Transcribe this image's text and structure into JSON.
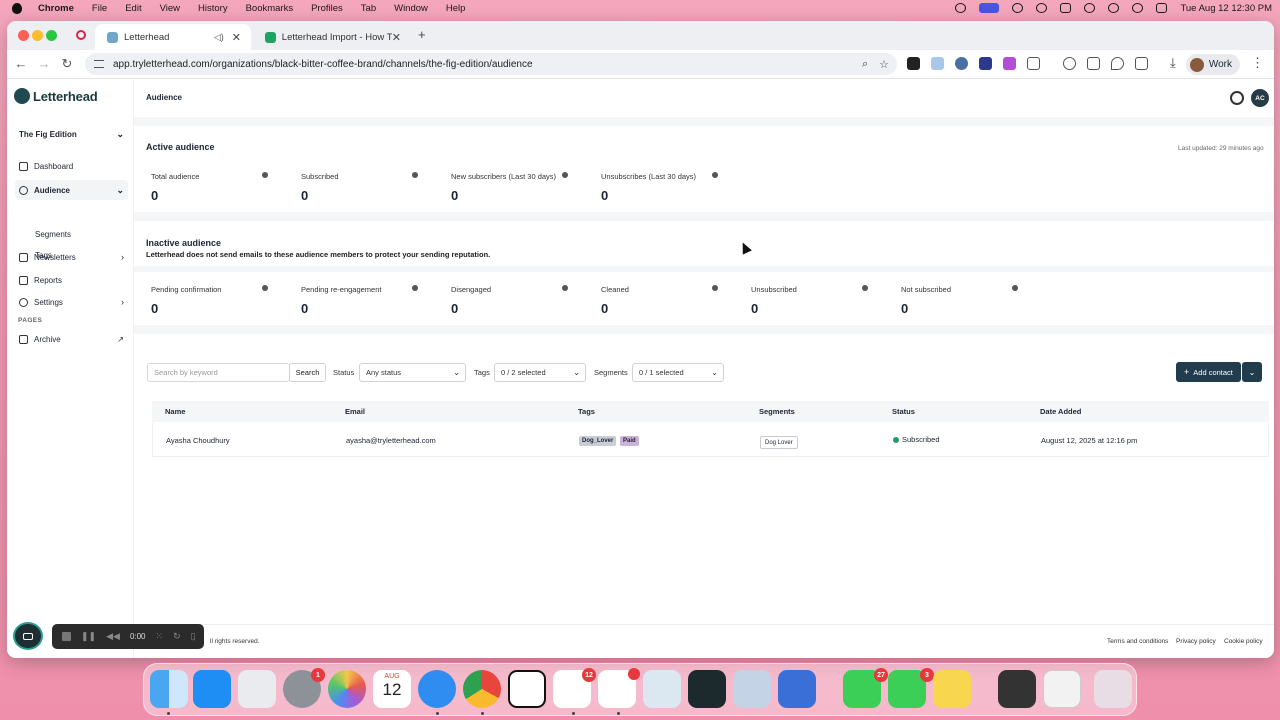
{
  "menubar": {
    "app": "Chrome",
    "items": [
      "File",
      "Edit",
      "View",
      "History",
      "Bookmarks",
      "Profiles",
      "Tab",
      "Window",
      "Help"
    ],
    "clock": "Tue Aug 12  12:30 PM"
  },
  "browser": {
    "tabs": [
      {
        "title": "Letterhead",
        "active": true
      },
      {
        "title": "Letterhead Import - How To C",
        "active": false
      }
    ],
    "url": "app.tryletterhead.com/organizations/black-bitter-coffee-brand/channels/the-fig-edition/audience",
    "profile": "Work"
  },
  "app": {
    "logo": "Letterhead",
    "channel": "The Fig Edition",
    "nav": {
      "dashboard": "Dashboard",
      "audience": "Audience",
      "segments": "Segments",
      "tags": "Tags",
      "newsletters": "Newsletters",
      "reports": "Reports",
      "settings": "Settings",
      "pages_header": "PAGES",
      "archive": "Archive"
    },
    "header": {
      "title": "Audience",
      "avatar": "AC"
    },
    "active": {
      "title": "Active audience",
      "updated": "Last updated: 29 minutes ago",
      "stats": [
        {
          "label": "Total audience",
          "value": "0"
        },
        {
          "label": "Subscribed",
          "value": "0"
        },
        {
          "label": "New subscribers (Last 30 days)",
          "value": "0"
        },
        {
          "label": "Unsubscribes (Last 30 days)",
          "value": "0"
        }
      ]
    },
    "inactive": {
      "title": "Inactive audience",
      "subtitle": "Letterhead does not send emails to these audience members to protect your sending reputation.",
      "stats": [
        {
          "label": "Pending confirmation",
          "value": "0"
        },
        {
          "label": "Pending re-engagement",
          "value": "0"
        },
        {
          "label": "Disengaged",
          "value": "0"
        },
        {
          "label": "Cleaned",
          "value": "0"
        },
        {
          "label": "Unsubscribed",
          "value": "0"
        },
        {
          "label": "Not subscribed",
          "value": "0"
        }
      ]
    },
    "filters": {
      "search_placeholder": "Search by keyword",
      "search_button": "Search",
      "status_label": "Status",
      "status_value": "Any status",
      "tags_label": "Tags",
      "tags_value": "0 / 2 selected",
      "segments_label": "Segments",
      "segments_value": "0 / 1 selected",
      "add_contact": "Add contact"
    },
    "table": {
      "columns": [
        "Name",
        "Email",
        "Tags",
        "Segments",
        "Status",
        "Date Added"
      ],
      "rows": [
        {
          "name": "Ayasha Choudhury",
          "email": "ayasha@tryletterhead.com",
          "tags": [
            "Dog_Lover",
            "Paid"
          ],
          "segment": "Dog Lover",
          "status": "Subscribed",
          "date_added": "August 12, 2025 at 12:16 pm"
        }
      ]
    },
    "footer": {
      "copyright": "ll rights reserved.",
      "links": [
        "Terms and conditions",
        "Privacy policy",
        "Cookie policy"
      ]
    }
  },
  "recorder": {
    "time": "0:00"
  },
  "dock": {
    "calendar_month": "AUG",
    "calendar_day": "12",
    "badges": {
      "settings": "1",
      "slack": "12",
      "facetime_like": "27",
      "phone": "3"
    }
  },
  "colors": {
    "primary": "#213c4c",
    "subscribed_dot": "#239b6b",
    "tag_bg": "#c9ced6",
    "paid_bg": "#c9b3d6",
    "desktop": "#f29bb4"
  }
}
